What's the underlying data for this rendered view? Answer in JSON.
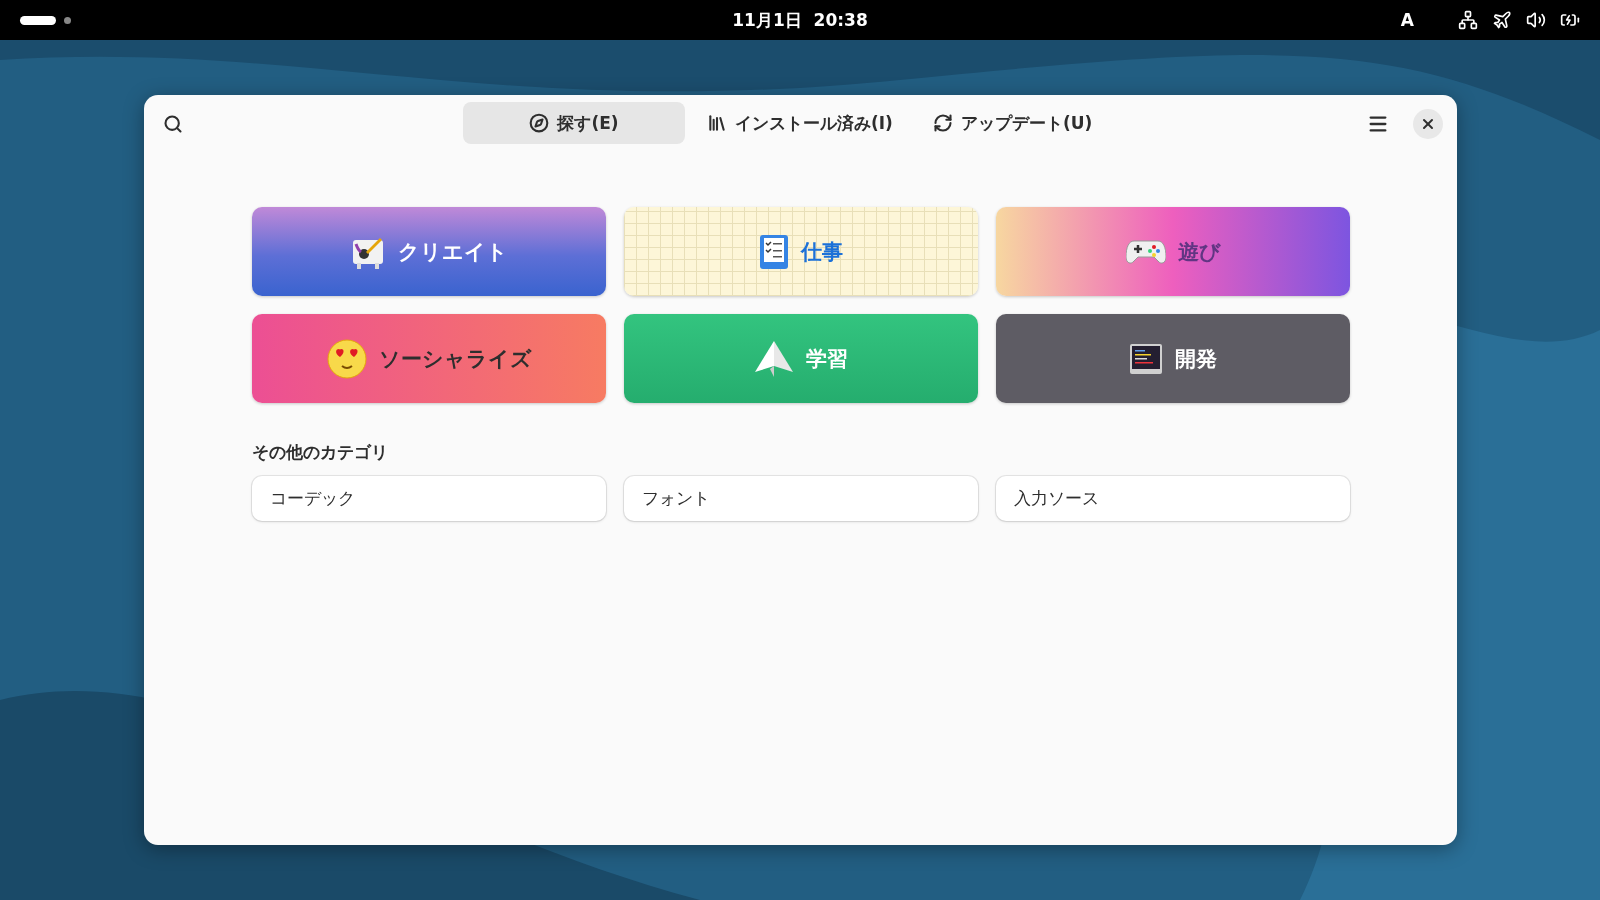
{
  "top_bar": {
    "clock": "11月1日  20:38",
    "input_source": "A"
  },
  "window": {
    "tabs": [
      {
        "label": "探す(E)",
        "selected": true
      },
      {
        "label": "インストール済み(I)",
        "selected": false
      },
      {
        "label": "アップデート(U)",
        "selected": false
      }
    ]
  },
  "featured_categories": [
    {
      "label": "クリエイト",
      "kind": "create"
    },
    {
      "label": "仕事",
      "kind": "work"
    },
    {
      "label": "遊び",
      "kind": "play"
    },
    {
      "label": "ソーシャライズ",
      "kind": "social"
    },
    {
      "label": "学習",
      "kind": "learn"
    },
    {
      "label": "開発",
      "kind": "develop"
    }
  ],
  "other_categories": {
    "heading": "その他のカテゴリ",
    "items": [
      "コーデック",
      "フォント",
      "入力ソース"
    ]
  }
}
